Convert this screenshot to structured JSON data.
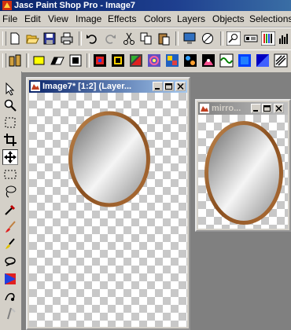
{
  "app": {
    "title": "Jasc Paint Shop Pro - Image7"
  },
  "menu": [
    "File",
    "Edit",
    "View",
    "Image",
    "Effects",
    "Colors",
    "Layers",
    "Objects",
    "Selections"
  ],
  "windows": {
    "main": {
      "title": "Image7* [1:2] (Layer..."
    },
    "mirror": {
      "title": "mirro..."
    }
  },
  "colors": {
    "frame": "#a0652e",
    "titlebar_active": "#0a246a"
  }
}
